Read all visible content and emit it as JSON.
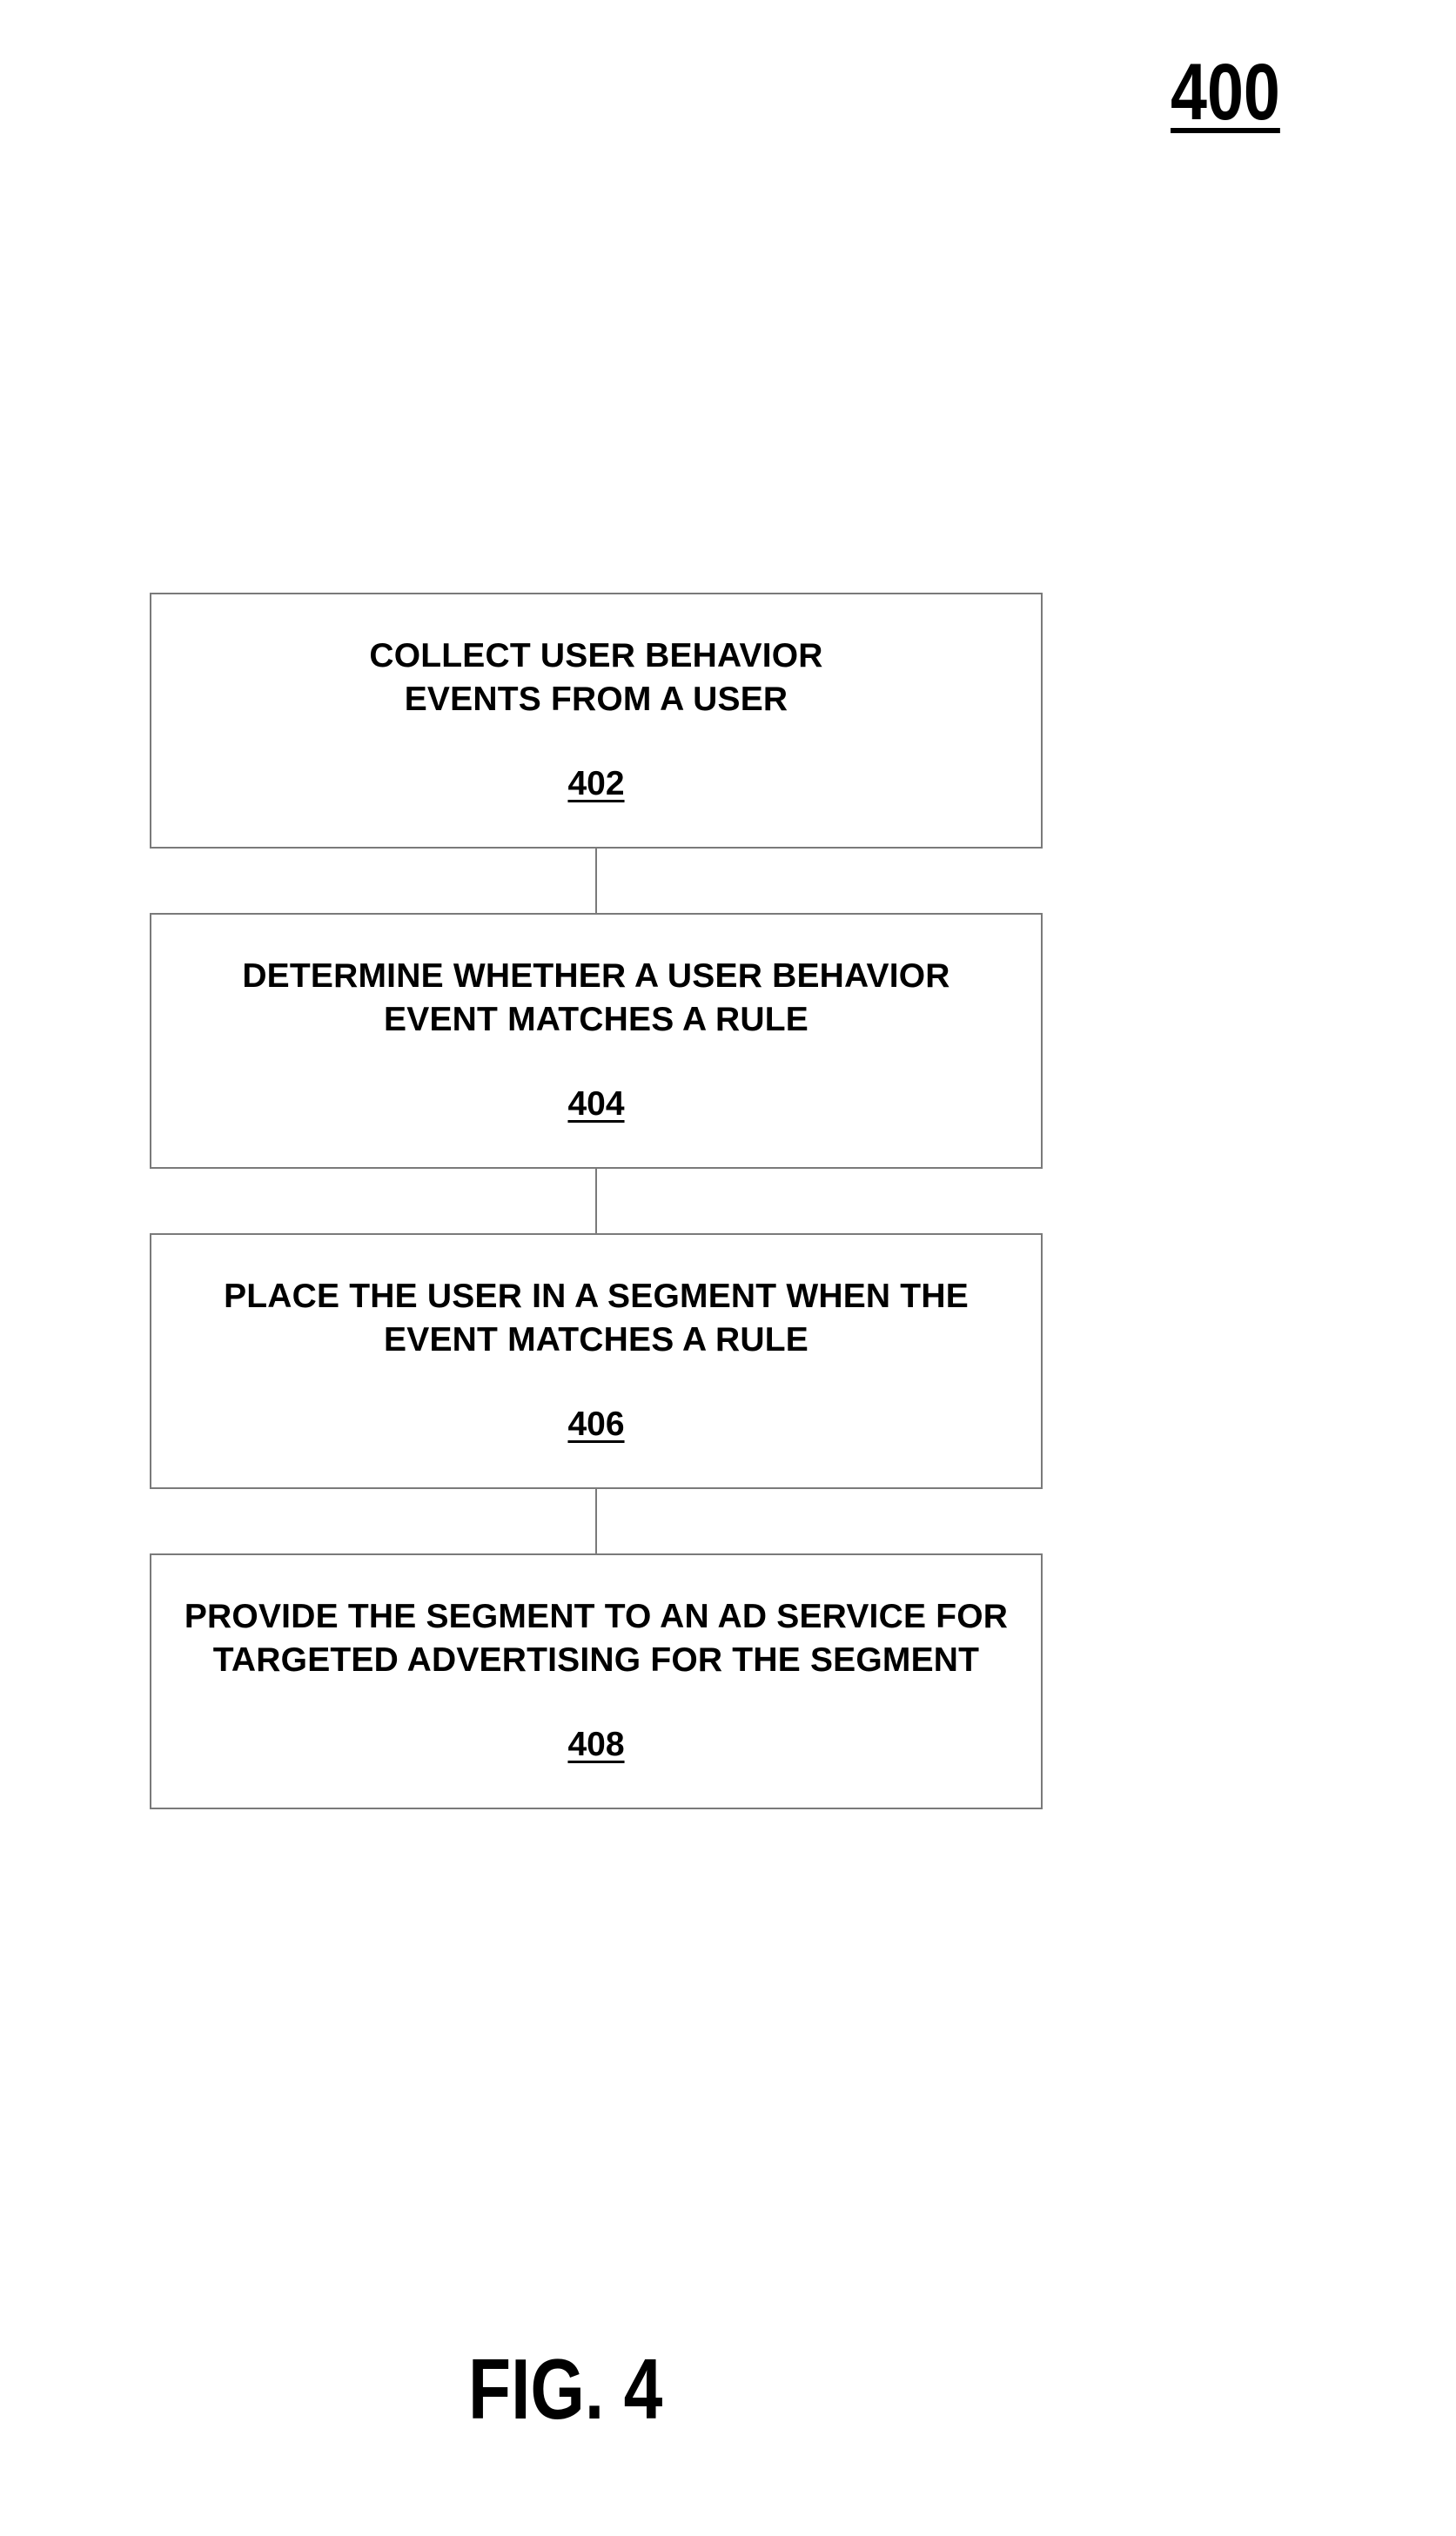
{
  "figure": {
    "number": "400",
    "label": "FIG. 4"
  },
  "steps": [
    {
      "text": "COLLECT USER BEHAVIOR EVENTS FROM A USER",
      "ref": "402"
    },
    {
      "text": "DETERMINE WHETHER A USER BEHAVIOR EVENT MATCHES A RULE",
      "ref": "404"
    },
    {
      "text": "PLACE THE USER IN A SEGMENT WHEN THE EVENT MATCHES A RULE",
      "ref": "406"
    },
    {
      "text": "PROVIDE THE SEGMENT TO AN AD SERVICE FOR TARGETED ADVERTISING FOR THE SEGMENT",
      "ref": "408"
    }
  ],
  "colors": {
    "box_border": "#7a7a7a",
    "text": "#000000",
    "background": "#ffffff"
  }
}
